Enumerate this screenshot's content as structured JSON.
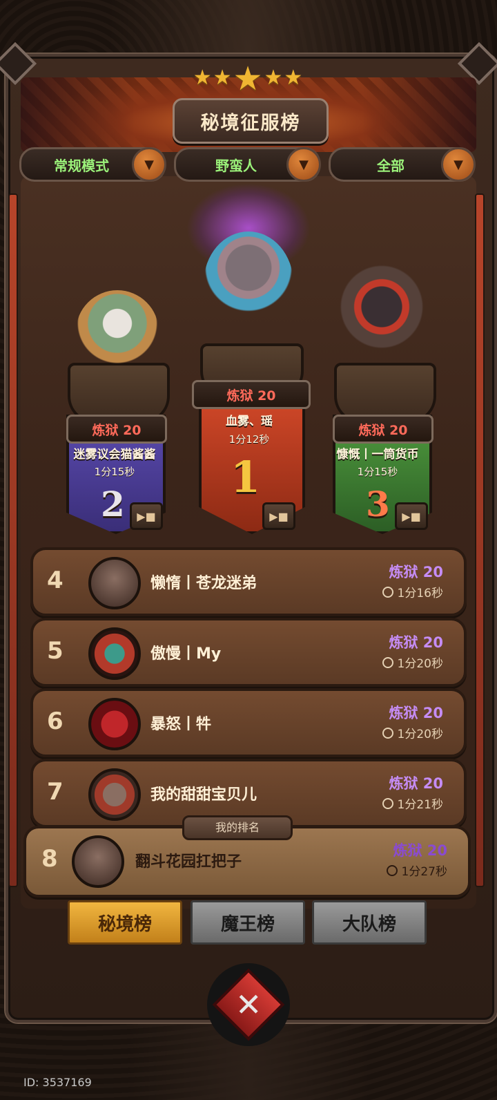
{
  "header": {
    "title": "秘境征服榜",
    "stars": "★★★★★"
  },
  "filters": [
    {
      "label": "常规模式"
    },
    {
      "label": "野蛮人"
    },
    {
      "label": "全部"
    }
  ],
  "podium": {
    "first": {
      "rank": "1",
      "level": "炼狱 20",
      "name": "血雾、瑶",
      "time": "1分12秒"
    },
    "second": {
      "rank": "2",
      "level": "炼狱 20",
      "name": "迷雾议会猫酱酱",
      "time": "1分15秒"
    },
    "third": {
      "rank": "3",
      "level": "炼狱 20",
      "name": "慷慨丨一筒货币",
      "time": "1分15秒"
    }
  },
  "list": [
    {
      "rank": "4",
      "name": "懒惰丨苍龙迷弟",
      "level": "炼狱 20",
      "time": "1分16秒"
    },
    {
      "rank": "5",
      "name": "傲慢丨My",
      "level": "炼狱 20",
      "time": "1分20秒"
    },
    {
      "rank": "6",
      "name": "暴怒丨牪",
      "level": "炼狱 20",
      "time": "1分20秒"
    },
    {
      "rank": "7",
      "name": "我的甜甜宝贝儿",
      "level": "炼狱 20",
      "time": "1分21秒"
    }
  ],
  "my_rank": {
    "tag": "我的排名",
    "rank": "8",
    "name": "翻斗花园扛把子",
    "level": "炼狱 20",
    "time": "1分27秒"
  },
  "tabs": [
    {
      "label": "秘境榜",
      "active": true
    },
    {
      "label": "魔王榜",
      "active": false
    },
    {
      "label": "大队榜",
      "active": false
    }
  ],
  "footer": {
    "close_glyph": "✕",
    "user_id": "ID: 3537169"
  },
  "colors": {
    "accent_gold": "#f0b632",
    "level_purple": "#c58cf5",
    "filter_green": "#9bf27a",
    "second_banner": "#5b4bb0",
    "first_banner": "#d64a2a",
    "third_banner": "#4f9a3e"
  }
}
